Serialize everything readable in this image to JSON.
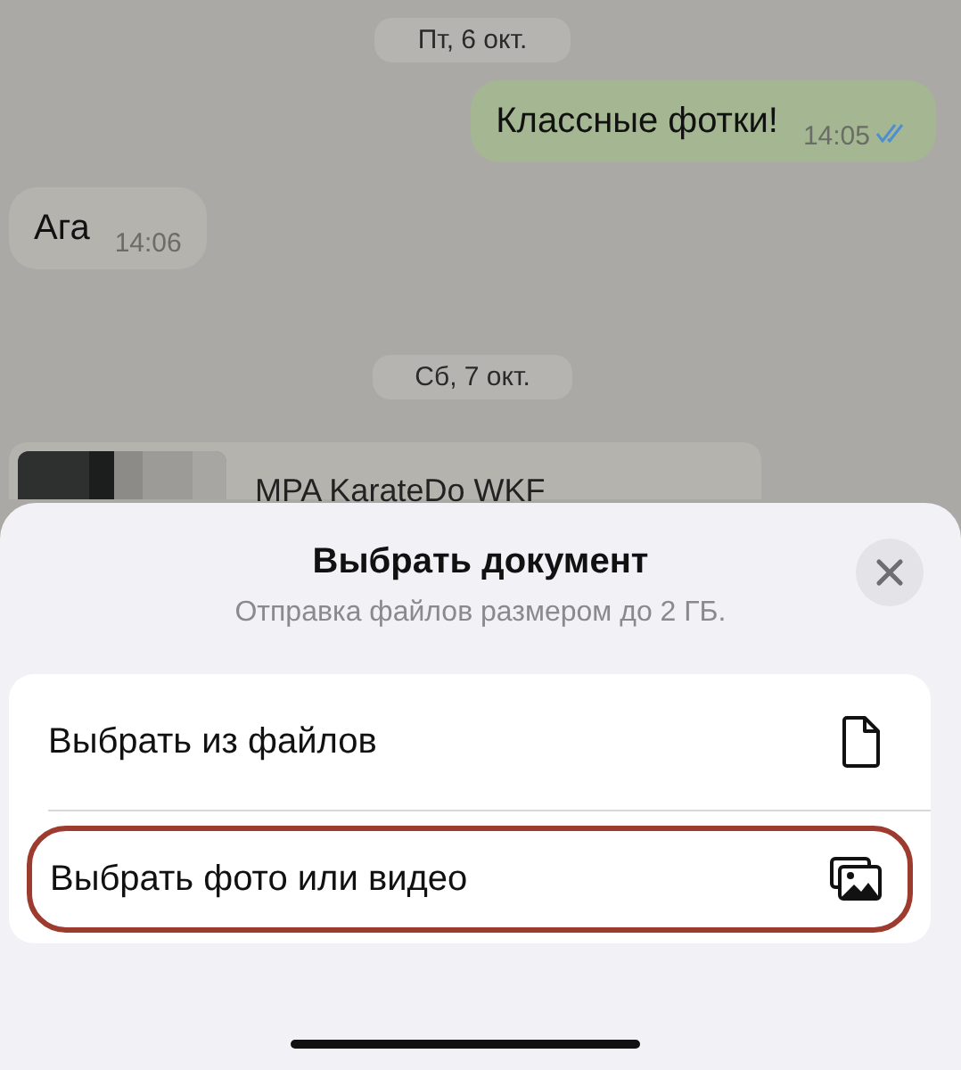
{
  "chat": {
    "messages": [
      {
        "kind": "date",
        "text": "Пт, 6 окт."
      },
      {
        "kind": "outgoing",
        "text": "Классные фотки!",
        "time": "14:05",
        "read": true
      },
      {
        "kind": "incoming",
        "text": "Ага",
        "time": "14:06"
      },
      {
        "kind": "date",
        "text": "Сб, 7 окт."
      },
      {
        "kind": "file",
        "text": "MPA KarateDo WKF"
      }
    ]
  },
  "sheet": {
    "title": "Выбрать документ",
    "subtitle": "Отправка файлов размером до 2 ГБ.",
    "options": [
      {
        "label": "Выбрать из файлов",
        "kind": "file",
        "highlighted": false
      },
      {
        "label": "Выбрать фото или видео",
        "kind": "photos",
        "highlighted": true
      }
    ]
  }
}
